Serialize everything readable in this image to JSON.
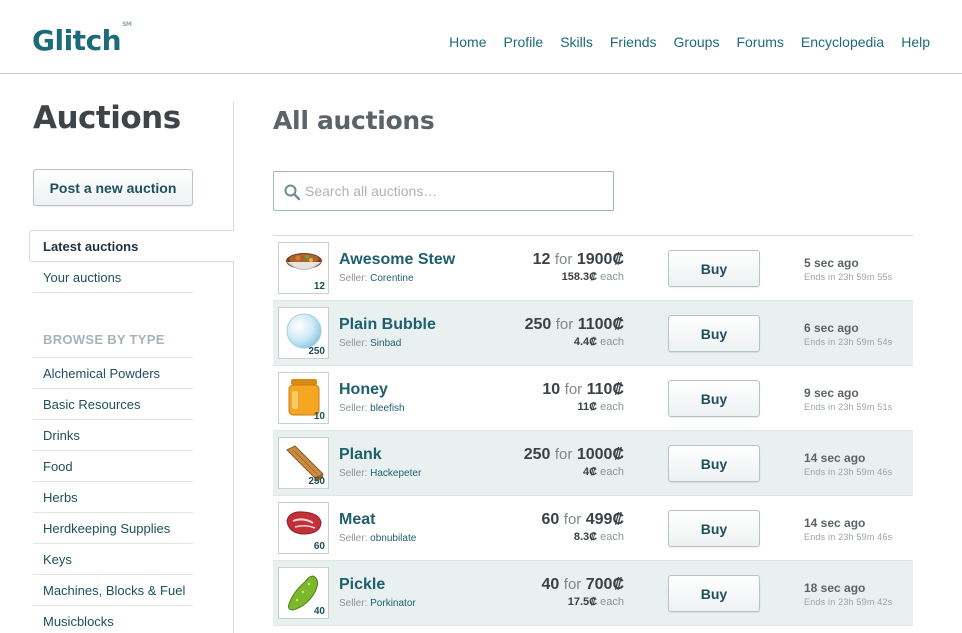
{
  "header": {
    "logo": "Glitch",
    "logo_mark": "SM",
    "nav": [
      "Home",
      "Profile",
      "Skills",
      "Friends",
      "Groups",
      "Forums",
      "Encyclopedia",
      "Help"
    ]
  },
  "sidebar": {
    "title": "Auctions",
    "post_button": "Post a new auction",
    "latest": "Latest auctions",
    "yours": "Your auctions",
    "browse_heading": "BROWSE BY TYPE",
    "types": [
      "Alchemical Powders",
      "Basic Resources",
      "Drinks",
      "Food",
      "Herbs",
      "Herdkeeping Supplies",
      "Keys",
      "Machines, Blocks & Fuel",
      "Musicblocks"
    ]
  },
  "main": {
    "title": "All auctions",
    "search_placeholder": "Search all auctions…",
    "seller_label": "Seller:",
    "for_label": "for",
    "each_label": "each",
    "buy_label": "Buy",
    "rows": [
      {
        "name": "Awesome Stew",
        "seller": "Corentine",
        "qty": "12",
        "qty_price": "12",
        "total": "1900₡",
        "each": "158.3₡",
        "ago": "5 sec ago",
        "ends": "Ends in 23h 59m 55s",
        "icon": "stew-icon"
      },
      {
        "name": "Plain Bubble",
        "seller": "Sinbad",
        "qty": "250",
        "qty_price": "250",
        "total": "1100₡",
        "each": "4.4₡",
        "ago": "6 sec ago",
        "ends": "Ends in 23h 59m 54s",
        "icon": "bubble-icon"
      },
      {
        "name": "Honey",
        "seller": "bleefish",
        "qty": "10",
        "qty_price": "10",
        "total": "110₡",
        "each": "11₡",
        "ago": "9 sec ago",
        "ends": "Ends in 23h 59m 51s",
        "icon": "honey-icon"
      },
      {
        "name": "Plank",
        "seller": "Hackepeter",
        "qty": "250",
        "qty_price": "250",
        "total": "1000₡",
        "each": "4₡",
        "ago": "14 sec ago",
        "ends": "Ends in 23h 59m 46s",
        "icon": "plank-icon"
      },
      {
        "name": "Meat",
        "seller": "obnubilate",
        "qty": "60",
        "qty_price": "60",
        "total": "499₡",
        "each": "8.3₡",
        "ago": "14 sec ago",
        "ends": "Ends in 23h 59m 46s",
        "icon": "meat-icon"
      },
      {
        "name": "Pickle",
        "seller": "Porkinator",
        "qty": "40",
        "qty_price": "40",
        "total": "700₡",
        "each": "17.5₡",
        "ago": "18 sec ago",
        "ends": "Ends in 23h 59m 42s",
        "icon": "pickle-icon"
      }
    ]
  },
  "colors": {
    "brand": "#1e6b78",
    "row_alt": "#e8f0f0"
  }
}
